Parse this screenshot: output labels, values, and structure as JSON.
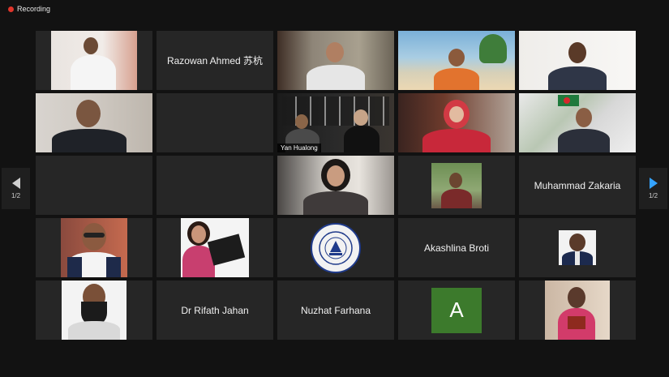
{
  "recording": {
    "label": "Recording"
  },
  "navigation": {
    "page_left": "1/2",
    "page_right": "1/2"
  },
  "tiles": [
    {
      "type": "video"
    },
    {
      "type": "name",
      "name": "Razowan Ahmed 苏杭"
    },
    {
      "type": "video"
    },
    {
      "type": "video"
    },
    {
      "type": "video"
    },
    {
      "type": "video"
    },
    {
      "type": "empty"
    },
    {
      "type": "video",
      "name": "Yan Hualong",
      "active": true
    },
    {
      "type": "video"
    },
    {
      "type": "video"
    },
    {
      "type": "empty"
    },
    {
      "type": "empty"
    },
    {
      "type": "video"
    },
    {
      "type": "picture"
    },
    {
      "type": "name",
      "name": "Muhammad Zakaria"
    },
    {
      "type": "picture"
    },
    {
      "type": "picture"
    },
    {
      "type": "logo"
    },
    {
      "type": "name",
      "name": "Akashlina Broti"
    },
    {
      "type": "picture"
    },
    {
      "type": "picture"
    },
    {
      "type": "name",
      "name": "Dr Rifath Jahan"
    },
    {
      "type": "name",
      "name": "Nuzhat Farhana"
    },
    {
      "type": "avatar",
      "letter": "A",
      "color": "#3c7a2c"
    },
    {
      "type": "picture"
    }
  ]
}
